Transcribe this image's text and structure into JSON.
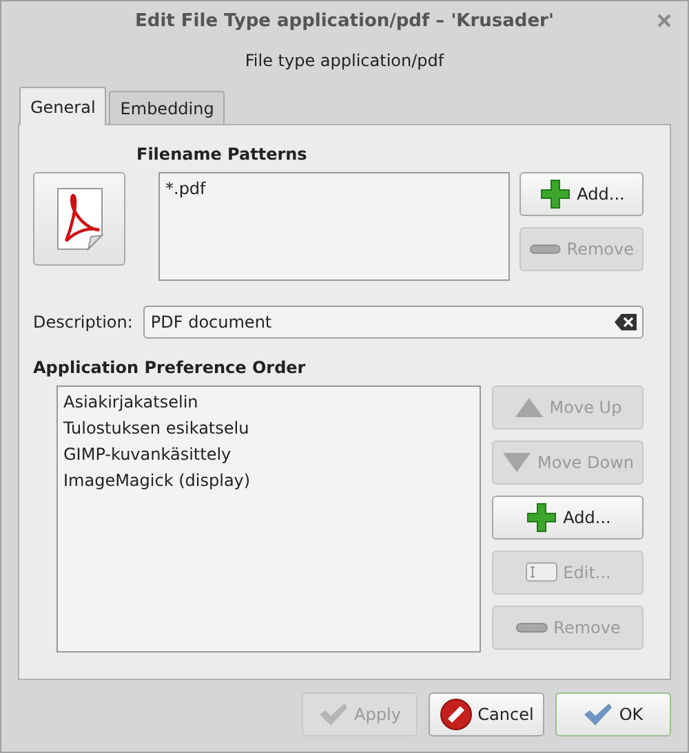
{
  "window": {
    "title": "Edit File Type application/pdf – 'Krusader'"
  },
  "subtitle": "File type application/pdf",
  "tabs": [
    {
      "label": "General",
      "selected": true
    },
    {
      "label": "Embedding",
      "selected": false
    }
  ],
  "filename_patterns": {
    "heading": "Filename Patterns",
    "items": [
      "*.pdf"
    ],
    "buttons": [
      {
        "label": "Add...",
        "kind": "plus",
        "disabled": false
      },
      {
        "label": "Remove",
        "kind": "minus",
        "disabled": true
      }
    ]
  },
  "description": {
    "label": "Description:",
    "value": "PDF document"
  },
  "application_preference_order": {
    "heading": "Application Preference Order",
    "items": [
      "Asiakirjakatselin",
      "Tulostuksen esikatselu",
      "GIMP-kuvankäsittely",
      "ImageMagick (display)"
    ],
    "buttons": [
      {
        "label": "Move Up",
        "kind": "up",
        "disabled": true
      },
      {
        "label": "Move Down",
        "kind": "down",
        "disabled": true
      },
      {
        "label": "Add...",
        "kind": "plus",
        "disabled": false
      },
      {
        "label": "Edit...",
        "kind": "edit",
        "disabled": true
      },
      {
        "label": "Remove",
        "kind": "minus",
        "disabled": true
      }
    ]
  },
  "buttons": [
    {
      "label": "Apply",
      "kind": "check",
      "disabled": true,
      "default": false
    },
    {
      "label": "Cancel",
      "kind": "cancel",
      "disabled": false,
      "default": false
    },
    {
      "label": "OK",
      "kind": "check",
      "disabled": false,
      "default": true
    }
  ]
}
